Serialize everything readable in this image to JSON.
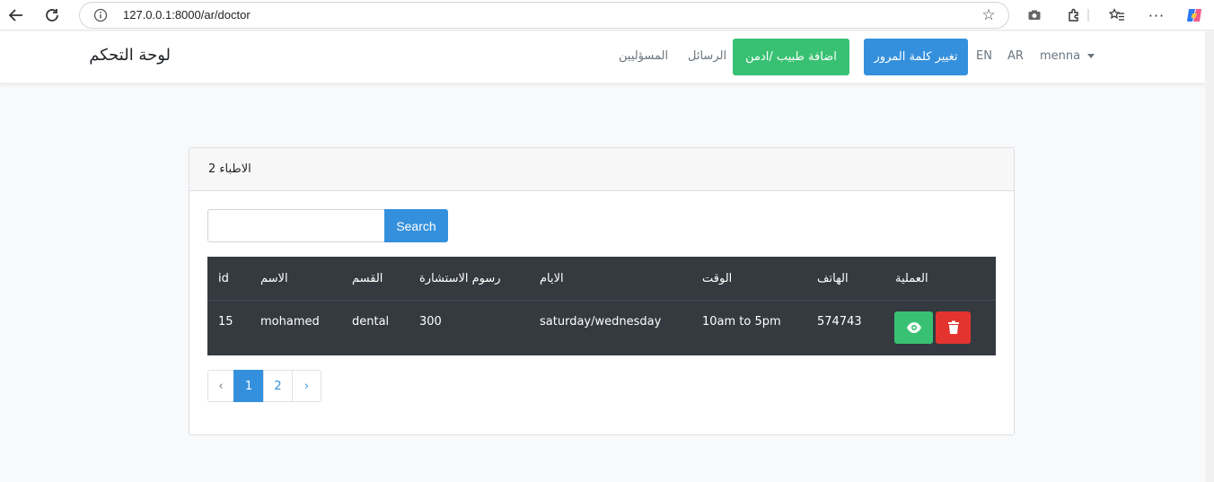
{
  "browser": {
    "url": "127.0.0.1:8000/ar/doctor"
  },
  "navbar": {
    "brand": "لوحة التحكم",
    "link_admins": "المسؤليين",
    "link_messages": "الرسائل",
    "add_doctor_button": "اضافة طبيب /ادمن",
    "change_password_button": "تغيير كلمة المرور",
    "lang_en": "EN",
    "lang_ar": "AR",
    "user": "menna"
  },
  "card": {
    "title": "الاطباء 2",
    "search": {
      "value": "",
      "button": "Search"
    },
    "table": {
      "headers": [
        "id",
        "الاسم",
        "القسم",
        "رسوم الاستشارة",
        "الايام",
        "الوقت",
        "الهاتف",
        "العملية"
      ],
      "rows": [
        {
          "id": "15",
          "name": "mohamed",
          "department": "dental",
          "fee": "300",
          "days": "saturday/wednesday",
          "time": "10am to 5pm",
          "phone": "574743"
        }
      ]
    },
    "pagination": {
      "prev": "‹",
      "pages": [
        "1",
        "2"
      ],
      "next": "›",
      "current": "1"
    }
  },
  "colors": {
    "primary": "#3490dc",
    "success": "#38c172",
    "danger": "#e3342f",
    "table_dark": "#343a40"
  },
  "icons": {
    "view": "eye-icon",
    "delete": "trash-icon"
  }
}
